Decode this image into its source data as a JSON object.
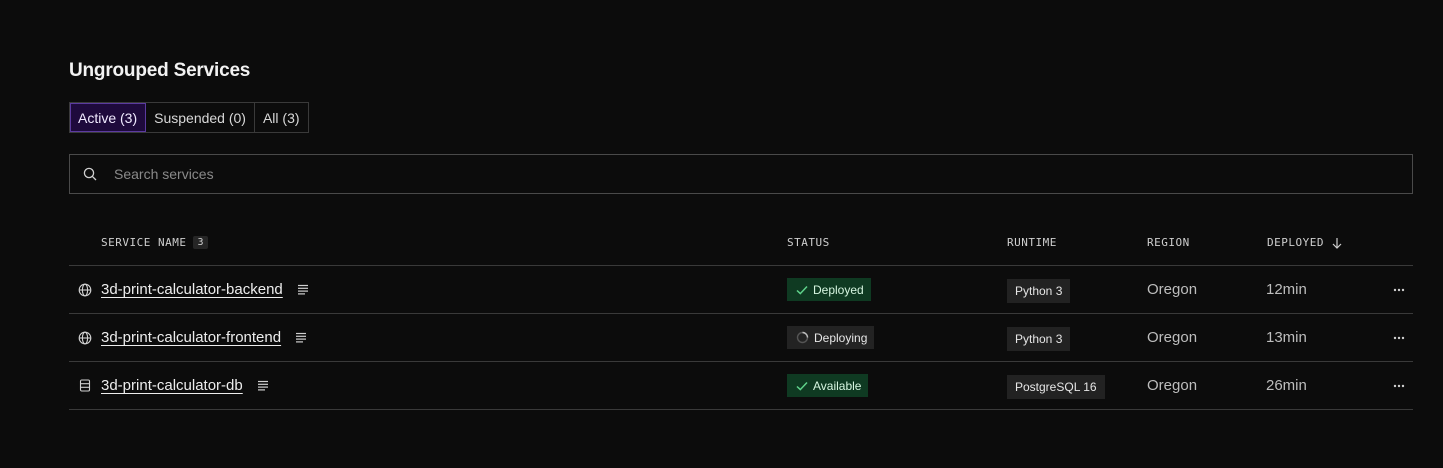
{
  "section": {
    "title": "Ungrouped Services"
  },
  "tabs": [
    {
      "label": "Active (3)"
    },
    {
      "label": "Suspended (0)"
    },
    {
      "label": "All (3)"
    }
  ],
  "search": {
    "placeholder": "Search services",
    "value": ""
  },
  "table": {
    "headers": {
      "service_name": "SERVICE NAME",
      "service_count": "3",
      "status": "STATUS",
      "runtime": "RUNTIME",
      "region": "REGION",
      "deployed": "DEPLOYED"
    },
    "rows": [
      {
        "icon": "globe-icon",
        "name": "3d-print-calculator-backend",
        "status": "Deployed",
        "status_kind": "success",
        "runtime": "Python 3",
        "region": "Oregon",
        "deployed": "12min"
      },
      {
        "icon": "globe-icon",
        "name": "3d-print-calculator-frontend",
        "status": "Deploying",
        "status_kind": "in-progress",
        "runtime": "Python 3",
        "region": "Oregon",
        "deployed": "13min"
      },
      {
        "icon": "database-icon",
        "name": "3d-print-calculator-db",
        "status": "Available",
        "status_kind": "success",
        "runtime": "PostgreSQL 16",
        "region": "Oregon",
        "deployed": "26min"
      }
    ]
  },
  "colors": {
    "background": "#0c0c0c",
    "active_tab": "#1e0a3c",
    "success_badge": "#0f3a22",
    "success_check": "#5fd38b"
  }
}
